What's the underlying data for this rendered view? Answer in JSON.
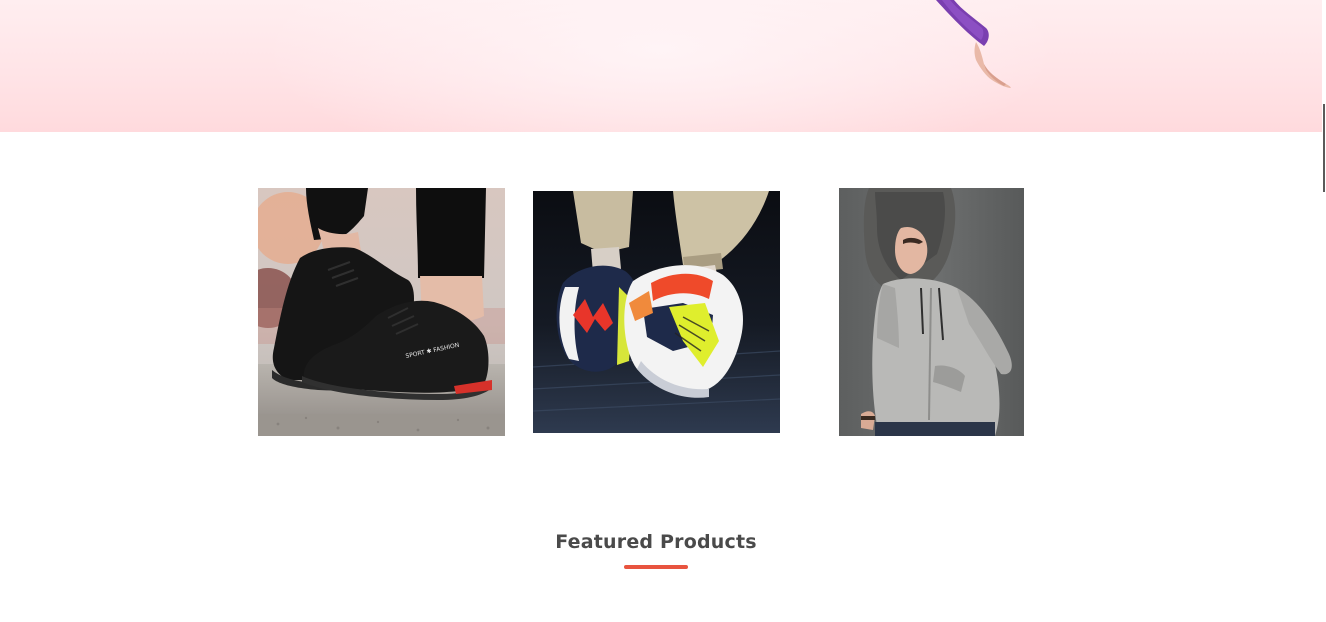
{
  "hero": {
    "image": "banner-model-arm",
    "background": "#ffe4e7"
  },
  "categories": [
    {
      "icon": "black-sneakers-image",
      "image_alt": "Black sport sneakers"
    },
    {
      "icon": "colorful-sneakers-image",
      "image_alt": "Colorful running sneakers"
    },
    {
      "icon": "grey-hoodie-image",
      "image_alt": "Woman in grey hoodie"
    }
  ],
  "sneaker_print": "SPORT ✱ FASHION",
  "featured": {
    "title": "Featured Products",
    "accent_color": "#e8543f"
  },
  "colors": {
    "title_text": "#4a4a4a",
    "accent": "#e8543f"
  }
}
